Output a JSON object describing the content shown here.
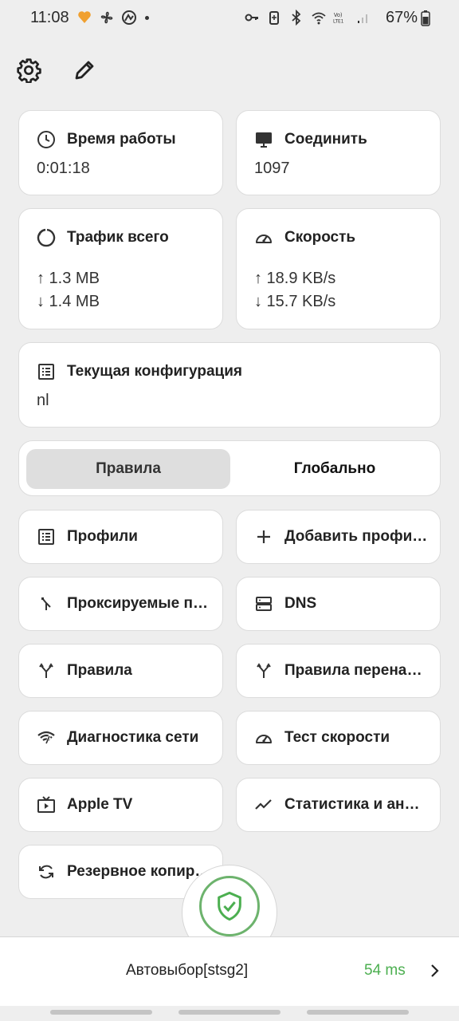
{
  "status_bar": {
    "time": "11:08",
    "battery": "67%",
    "left_icons": [
      "heart-bolt-icon",
      "fan-icon",
      "logo-icon",
      "dot-icon"
    ],
    "right_icons": [
      "key-icon",
      "battery-saver-icon",
      "bluetooth-icon",
      "wifi-icon",
      "volte-icon",
      "signal-icon",
      "battery-icon"
    ]
  },
  "toolbar": {
    "icons": [
      "gear-icon",
      "pencil-icon"
    ]
  },
  "stats": {
    "uptime": {
      "title": "Время работы",
      "value": "0:01:18"
    },
    "connections": {
      "title": "Соединить",
      "value": "1097"
    },
    "traffic": {
      "title": "Трафик всего",
      "up": "↑ 1.3 MB",
      "down": "↓ 1.4 MB"
    },
    "speed": {
      "title": "Скорость",
      "up": "↑ 18.9 KB/s",
      "down": "↓ 15.7 KB/s"
    },
    "config": {
      "title": "Текущая конфигурация",
      "value": "nl"
    }
  },
  "mode": {
    "rules_label": "Правила",
    "global_label": "Глобально",
    "selected": "rules"
  },
  "tiles": [
    {
      "label": "Профили",
      "icon": "list-icon"
    },
    {
      "label": "Добавить профиль",
      "icon": "plus-icon"
    },
    {
      "label": "Проксируемые приложения",
      "icon": "merge-icon"
    },
    {
      "label": "DNS",
      "icon": "server-icon"
    },
    {
      "label": "Правила",
      "icon": "fork-icon"
    },
    {
      "label": "Правила переназначения",
      "icon": "fork-icon"
    },
    {
      "label": "Диагностика сети",
      "icon": "wifi-check-icon"
    },
    {
      "label": "Тест скорости",
      "icon": "speedometer-icon"
    },
    {
      "label": "Apple TV",
      "icon": "tv-icon"
    },
    {
      "label": "Статистика и аналитика",
      "icon": "trend-icon"
    },
    {
      "label": "Резервное копирование",
      "icon": "backup-icon"
    }
  ],
  "bottom": {
    "proxy": "Автовыбор[stsg2]",
    "latency": "54 ms",
    "connected_color": "#4caf50"
  }
}
